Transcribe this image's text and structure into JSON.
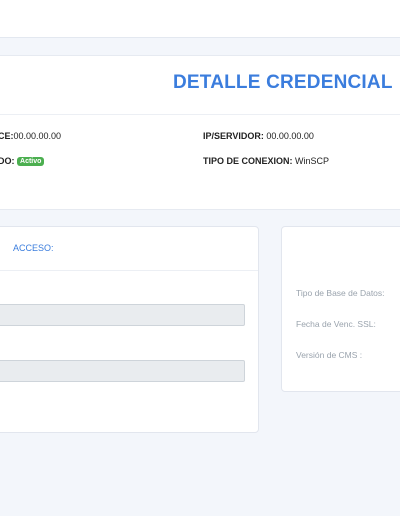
{
  "header": {
    "title": "DETALLE CREDENCIAL",
    "ip_left": {
      "label": "CE:",
      "value": "00.00.00.00"
    },
    "ip_servidor": {
      "label": "IP/SERVIDOR:",
      "value": "00.00.00.00"
    },
    "estado": {
      "label": "DO:",
      "badge": "Activo"
    },
    "tipo_conexion": {
      "label": "TIPO DE CONEXION:",
      "value": "WinSCP"
    }
  },
  "access_panel": {
    "tab_label": "ACCESO:",
    "fields": [
      {
        "value": ""
      },
      {
        "value": ""
      }
    ]
  },
  "details_panel": {
    "tipo_bd_label": "Tipo de Base de Datos:",
    "fecha_ssl_label": "Fecha de Venc. SSL:",
    "version_cms_label": "Versión de CMS :"
  },
  "colors": {
    "accent": "#3b7ddd",
    "badge_active": "#4caf50",
    "background": "#f3f6fb"
  }
}
